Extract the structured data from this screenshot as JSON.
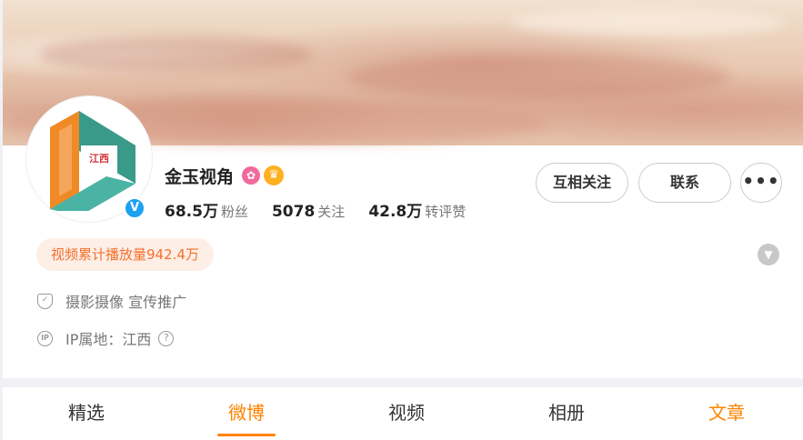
{
  "profile": {
    "name": "金玉视角",
    "verified_icon": "verified-v-icon",
    "badges": [
      "pink-badge-icon",
      "crown-badge-icon"
    ],
    "stats": [
      {
        "num": "68.5万",
        "label": "粉丝"
      },
      {
        "num": "5078",
        "label": "关注"
      },
      {
        "num": "42.8万",
        "label": "转评赞"
      }
    ],
    "play_count": "视频累计播放量942.4万",
    "tags_line": "摄影摄像 宣传推广",
    "ip_location": "IP属地：江西"
  },
  "actions": {
    "follow": "互相关注",
    "contact": "联系",
    "more": "•••"
  },
  "tabs": [
    {
      "label": "精选"
    },
    {
      "label": "微博"
    },
    {
      "label": "视频"
    },
    {
      "label": "相册"
    },
    {
      "label": "文章"
    }
  ],
  "colors": {
    "accent": "#ff8200",
    "play_badge_bg": "#fdeee6",
    "play_badge_text": "#f4702d",
    "verified": "#1da1f2"
  }
}
